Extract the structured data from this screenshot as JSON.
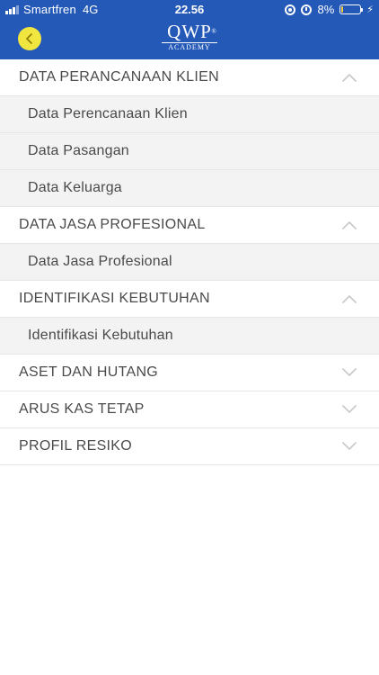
{
  "status_bar": {
    "carrier": "Smartfren",
    "network": "4G",
    "time": "22.56",
    "battery": "8%",
    "battery_level": 0.08
  },
  "header": {
    "logo_main": "QWP",
    "logo_reg": "®",
    "logo_sub": "ACADEMY",
    "back_icon": "chevron-left-icon"
  },
  "sections": [
    {
      "label": "DATA PERANCANAAN KLIEN",
      "expanded": true,
      "items": [
        "Data Perencanaan Klien",
        "Data Pasangan",
        "Data Keluarga"
      ]
    },
    {
      "label": "DATA JASA PROFESIONAL",
      "expanded": true,
      "items": [
        "Data Jasa Profesional"
      ]
    },
    {
      "label": "IDENTIFIKASI KEBUTUHAN",
      "expanded": true,
      "items": [
        "Identifikasi Kebutuhan"
      ]
    },
    {
      "label": "ASET DAN HUTANG",
      "expanded": false,
      "items": []
    },
    {
      "label": "ARUS KAS TETAP",
      "expanded": false,
      "items": []
    },
    {
      "label": "PROFIL RESIKO",
      "expanded": false,
      "items": []
    }
  ],
  "colors": {
    "header_bg": "#2459b8",
    "back_button": "#f1e640",
    "sub_item_bg": "#f3f3f3",
    "text": "#4a4a4a",
    "chevron": "#c8c8c8"
  }
}
